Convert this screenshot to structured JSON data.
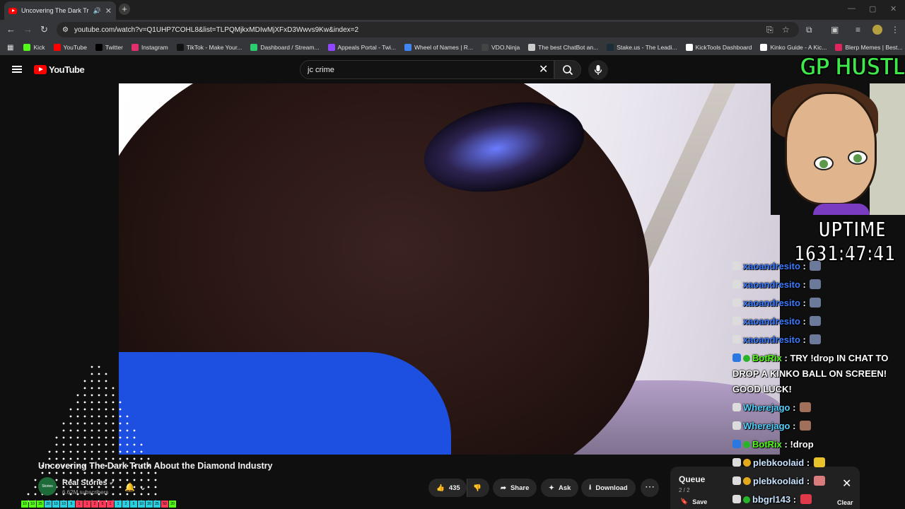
{
  "browser": {
    "tab_title": "Uncovering The Dark Truth",
    "url": "youtube.com/watch?v=Q1UHP7COHL8&list=TLPQMjkxMDIwMjXFxD3Wwvs9Kw&index=2",
    "bookmarks": [
      {
        "label": "Kick",
        "color": "#53fc18"
      },
      {
        "label": "YouTube",
        "color": "#ff0000"
      },
      {
        "label": "Twitter",
        "color": "#000000"
      },
      {
        "label": "Instagram",
        "color": "#e1306c"
      },
      {
        "label": "TikTok - Make Your...",
        "color": "#111111"
      },
      {
        "label": "Dashboard / Stream...",
        "color": "#2ecc71"
      },
      {
        "label": "Appeals Portal - Twi...",
        "color": "#9146ff"
      },
      {
        "label": "Wheel of Names | R...",
        "color": "#4285f4"
      },
      {
        "label": "VDO.Ninja",
        "color": "#444444"
      },
      {
        "label": "The best ChatBot an...",
        "color": "#cccccc"
      },
      {
        "label": "Stake.us - The Leadi...",
        "color": "#1a2c38"
      },
      {
        "label": "KickTools Dashboard",
        "color": "#ffffff"
      },
      {
        "label": "Kinko Guide - A Kic...",
        "color": "#ffffff"
      },
      {
        "label": "Blerp Memes | Best...",
        "color": "#e0245e"
      }
    ]
  },
  "youtube": {
    "logo": "YouTube",
    "search_value": "jc crime",
    "video": {
      "title": "Uncovering The Dark Truth About the Diamond Industry",
      "channel": "Real Stories",
      "channel_avatar_text": "Stories",
      "subscribers": "6.62M subscribers",
      "likes": "435",
      "share_label": "Share",
      "ask_label": "Ask",
      "download_label": "Download"
    },
    "queue": {
      "title": "Queue",
      "count": "2 / 2",
      "save_label": "Save",
      "clear_label": "Clear"
    }
  },
  "overlay": {
    "brand": "GP HUSTLA",
    "uptime_label": "UPTIME",
    "uptime_value": "1631:47:41",
    "chat": [
      {
        "user": "xaoandresito",
        "text": "",
        "color": "#3a7bff"
      },
      {
        "user": "xaoandresito",
        "text": "",
        "color": "#3a7bff"
      },
      {
        "user": "xaoandresito",
        "text": "",
        "color": "#3a7bff"
      },
      {
        "user": "xaoandresito",
        "text": "",
        "color": "#3a7bff"
      },
      {
        "user": "xaoandresito",
        "text": "",
        "color": "#3a7bff"
      },
      {
        "user": "BotRix",
        "text": "TRY !drop IN CHAT TO DROP A KINKO BALL ON SCREEN! GOOD LUCK!",
        "color": "#53fc18"
      },
      {
        "user": "Wherejago",
        "text": "",
        "color": "#53d0fc"
      },
      {
        "user": "Wherejago",
        "text": "",
        "color": "#53d0fc"
      },
      {
        "user": "BotRix",
        "text": "!drop",
        "color": "#53fc18"
      },
      {
        "user": "plebkoolaid",
        "text": "",
        "color": "#c9e3ff"
      },
      {
        "user": "plebkoolaid",
        "text": "",
        "color": "#c9e3ff"
      },
      {
        "user": "bbgrl143",
        "text": "",
        "color": "#c9e3ff"
      }
    ],
    "stat_row": [
      "10",
      "10",
      "25",
      "20",
      "10",
      "10",
      "5",
      "1",
      "1",
      "2",
      "5",
      "1",
      "1",
      "2",
      "5",
      "10",
      "20",
      "25",
      "50",
      "20"
    ]
  }
}
